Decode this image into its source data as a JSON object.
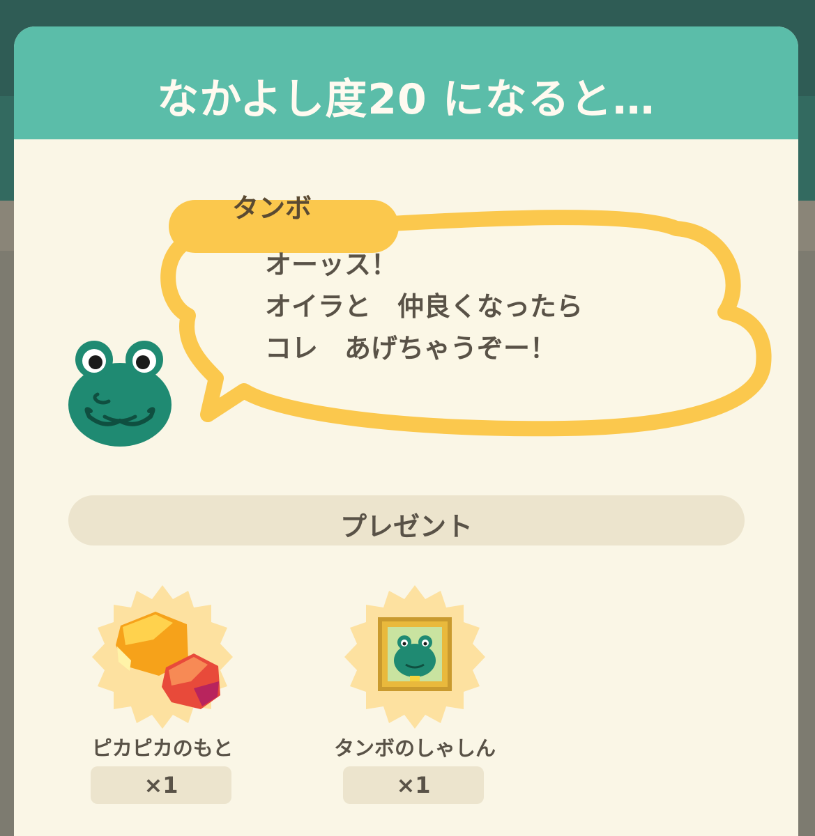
{
  "dialog": {
    "title": "なかよし度20 になると…"
  },
  "speaker": {
    "name": "タンボ"
  },
  "speech": {
    "lines": [
      "オーッス！",
      "オイラと　仲良くなったら",
      "コレ　あげちゃうぞー！"
    ]
  },
  "present": {
    "heading": "プレゼント",
    "items": [
      {
        "name": "ピカピカのもと",
        "quantity": "×1",
        "icon": "sparkle-gem-icon"
      },
      {
        "name": "タンボのしゃしん",
        "quantity": "×1",
        "icon": "framed-photo-icon"
      }
    ]
  },
  "colors": {
    "header": "#5bbda9",
    "panel": "#faf6e6",
    "bubble_outline": "#fbc84d",
    "frog": "#1f8a72"
  }
}
